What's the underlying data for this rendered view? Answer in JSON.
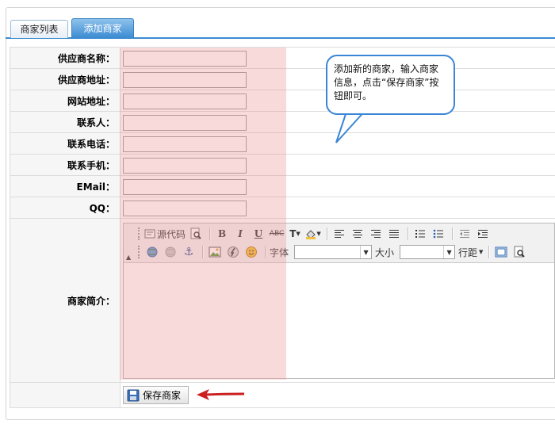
{
  "tabs": [
    {
      "label": "商家列表",
      "active": false
    },
    {
      "label": "添加商家",
      "active": true
    }
  ],
  "form": {
    "fields": [
      {
        "label": "供应商名称：",
        "value": ""
      },
      {
        "label": "供应商地址：",
        "value": ""
      },
      {
        "label": "网站地址：",
        "value": ""
      },
      {
        "label": "联系人：",
        "value": ""
      },
      {
        "label": "联系电话：",
        "value": ""
      },
      {
        "label": "联系手机：",
        "value": ""
      },
      {
        "label": "EMail：",
        "value": ""
      },
      {
        "label": "QQ：",
        "value": ""
      }
    ],
    "intro_label": "商家简介："
  },
  "editor": {
    "source_label": "源代码",
    "font_label": "字体",
    "size_label": "大小",
    "line_spacing_label": "行距",
    "font_value": "",
    "size_value": ""
  },
  "save_button": {
    "label": "保存商家"
  },
  "callout": {
    "text": "添加新的商家，输入商家信息，点击“保存商家”按钮即可。"
  },
  "colors": {
    "tab_active": "#3b8bd2",
    "highlight": "#f4caca",
    "callout_border": "#3a86d6",
    "arrow": "#cc2020"
  }
}
